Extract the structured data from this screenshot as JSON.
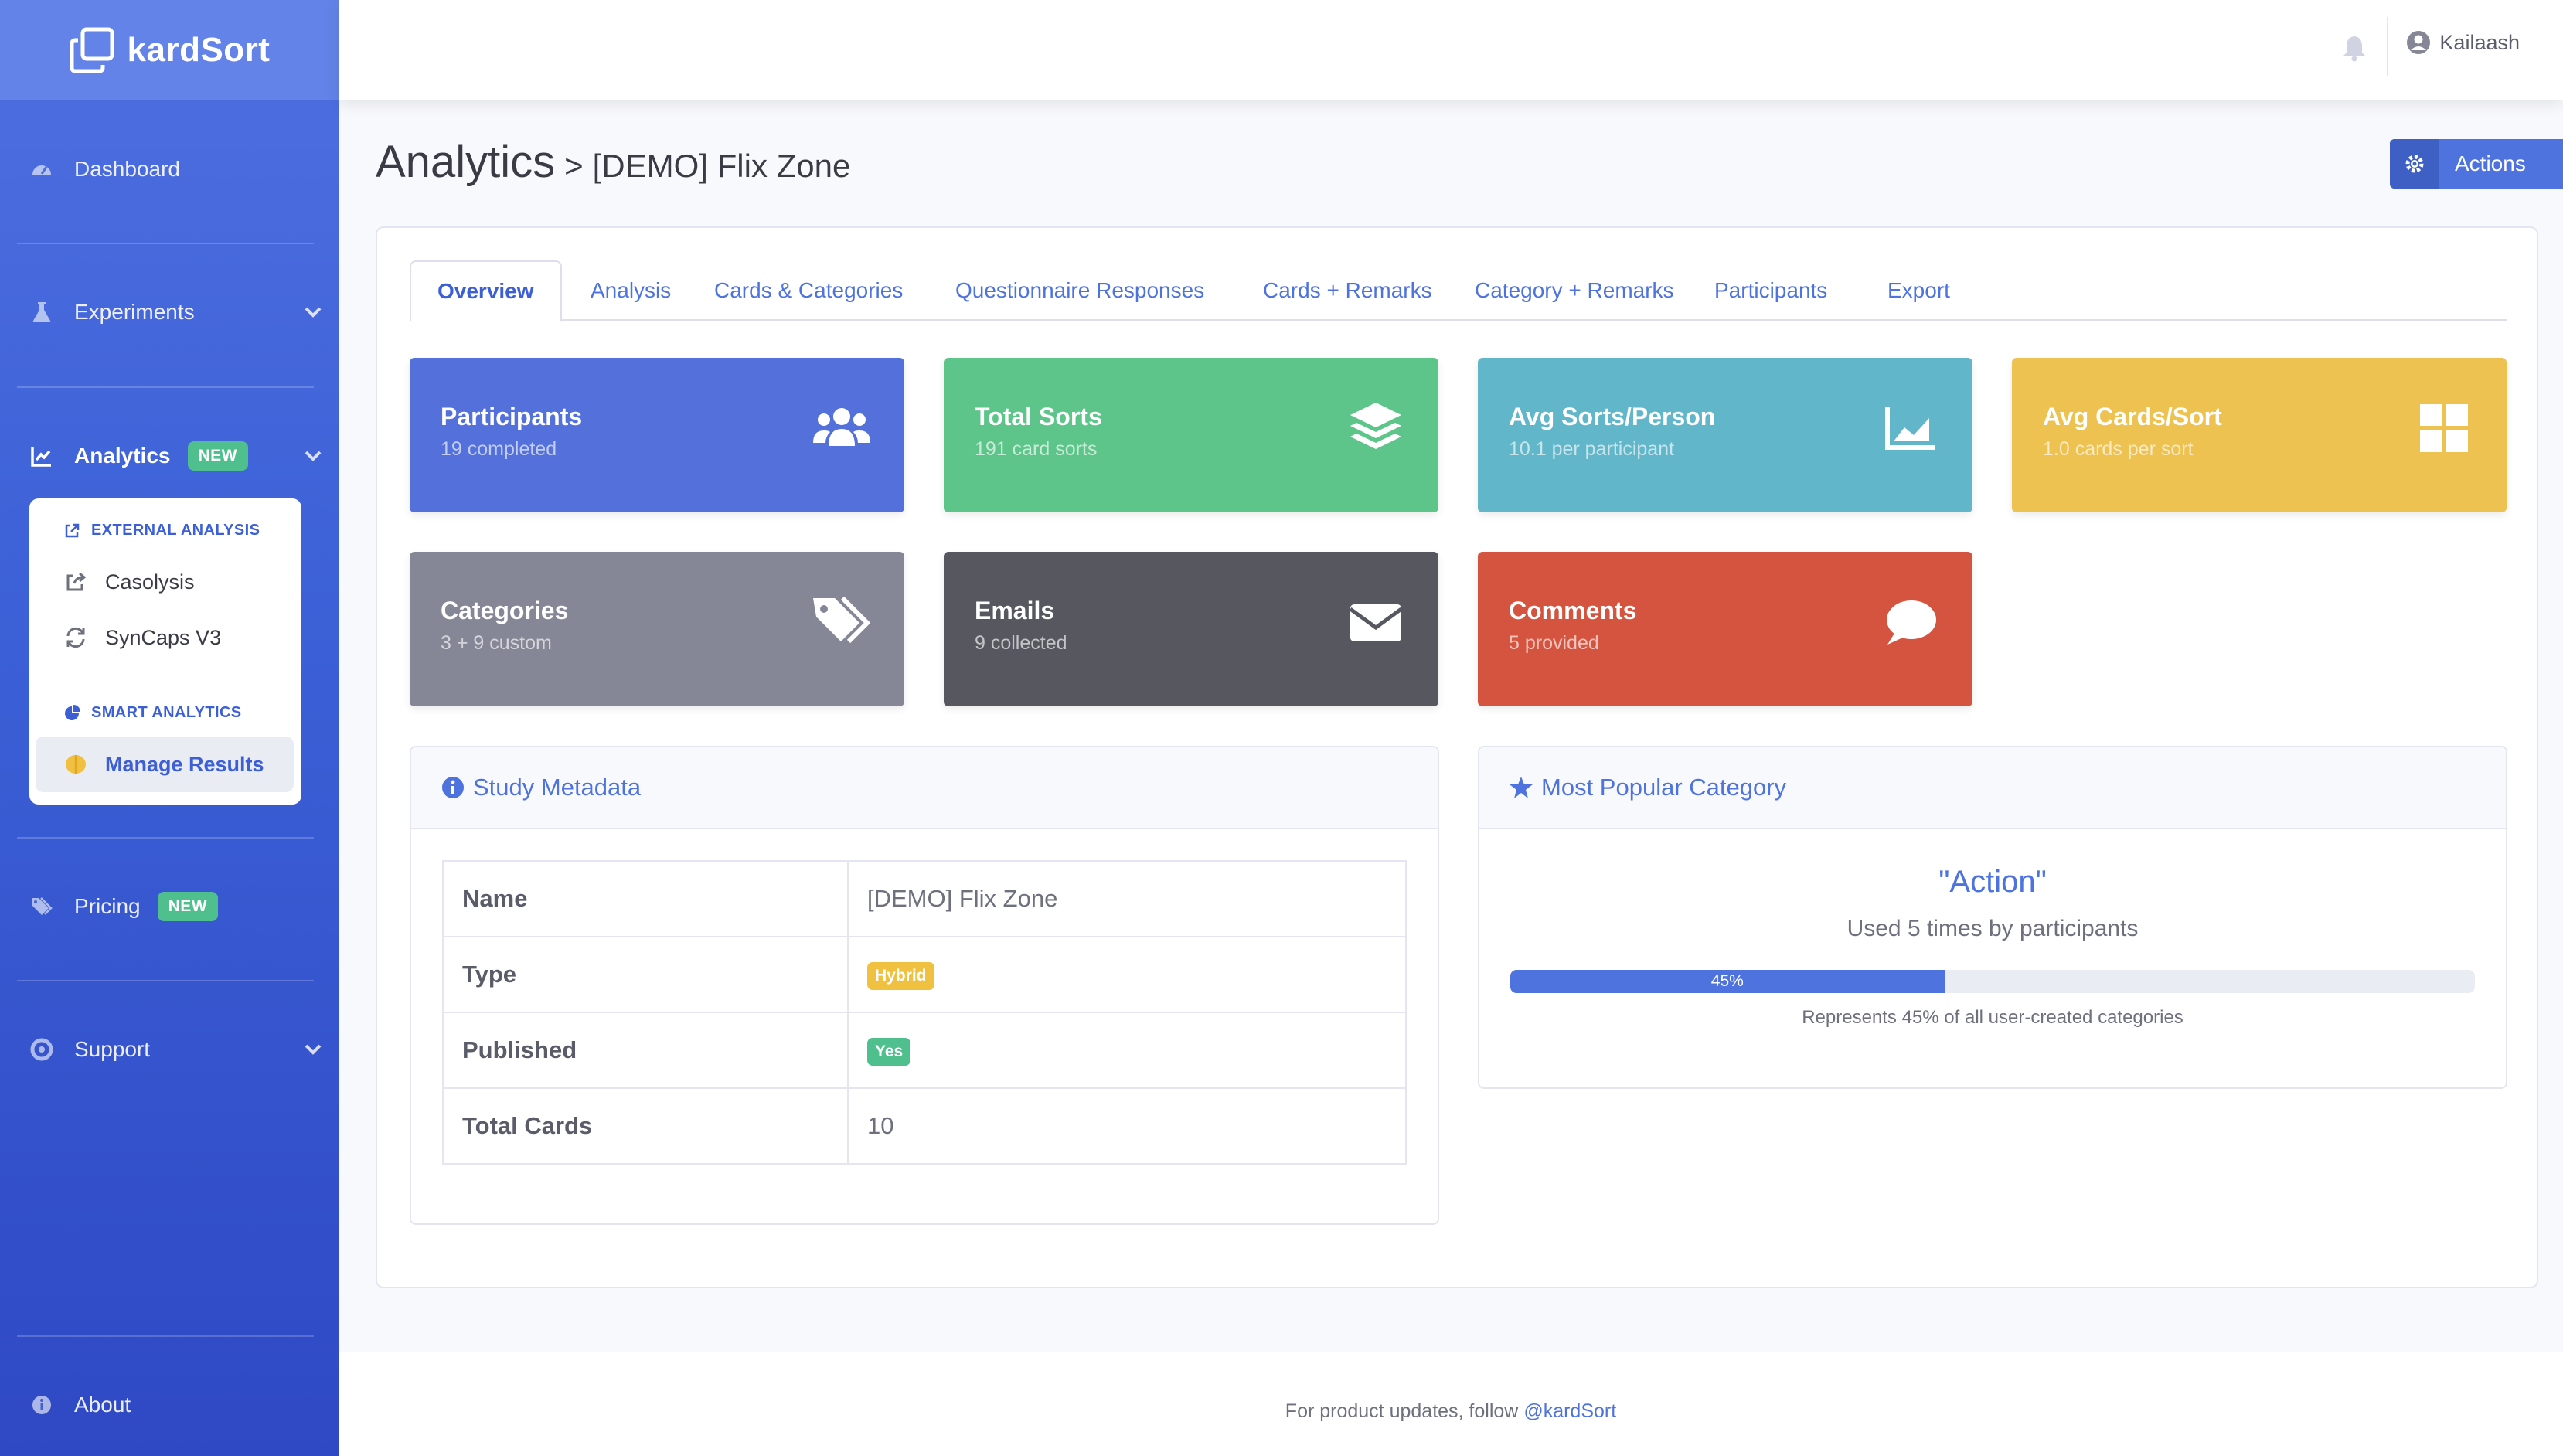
{
  "app": {
    "brand": "kardSort"
  },
  "sidebar": {
    "items": [
      {
        "label": "Dashboard",
        "icon": "gauge-icon"
      },
      {
        "label": "Experiments",
        "icon": "flask-icon"
      },
      {
        "label": "Analytics",
        "icon": "chart-line-icon",
        "badge": "NEW"
      },
      {
        "label": "Pricing",
        "icon": "tags-icon",
        "badge": "NEW"
      },
      {
        "label": "Support",
        "icon": "life-ring-icon"
      },
      {
        "label": "About",
        "icon": "info-circle-icon"
      }
    ],
    "submenu": {
      "external_header": "EXTERNAL ANALYSIS",
      "external_items": [
        {
          "label": "Casolysis",
          "icon": "share-square-icon"
        },
        {
          "label": "SynCaps V3",
          "icon": "sync-icon"
        }
      ],
      "smart_header": "SMART ANALYTICS",
      "smart_items": [
        {
          "label": "Manage Results",
          "icon": "brain-icon"
        }
      ]
    }
  },
  "topbar": {
    "user": "Kailaash"
  },
  "page": {
    "title": "Analytics",
    "separator": ">",
    "subtitle": "[DEMO] Flix Zone",
    "actions_label": "Actions"
  },
  "tabs": [
    "Overview",
    "Analysis",
    "Cards & Categories",
    "Questionnaire Responses",
    "Cards + Remarks",
    "Category + Remarks",
    "Participants",
    "Export"
  ],
  "stats": [
    {
      "title": "Participants",
      "sub": "19 completed",
      "color": "#5470db",
      "icon": "users-icon"
    },
    {
      "title": "Total Sorts",
      "sub": "191 card sorts",
      "color": "#5ec58a",
      "icon": "layer-group-icon"
    },
    {
      "title": "Avg Sorts/Person",
      "sub": "10.1 per participant",
      "color": "#62b6c9",
      "icon": "chart-area-icon"
    },
    {
      "title": "Avg Cards/Sort",
      "sub": "1.0 cards per sort",
      "color": "#edc251",
      "icon": "grid-icon"
    },
    {
      "title": "Categories",
      "sub": "3 + 9 custom",
      "color": "#858796",
      "icon": "tags-icon"
    },
    {
      "title": "Emails",
      "sub": "9 collected",
      "color": "#56575f",
      "icon": "envelope-icon"
    },
    {
      "title": "Comments",
      "sub": "5 provided",
      "color": "#d55440",
      "icon": "comment-icon"
    }
  ],
  "metadata": {
    "title": "Study Metadata",
    "rows": [
      {
        "key": "Name",
        "value": "[DEMO] Flix Zone"
      },
      {
        "key": "Type",
        "value": "Hybrid",
        "pill_color": "#f0c040"
      },
      {
        "key": "Published",
        "value": "Yes",
        "pill_color": "#4fc08d"
      },
      {
        "key": "Total Cards",
        "value": "10"
      }
    ]
  },
  "popular": {
    "title": "Most Popular Category",
    "name": "\"Action\"",
    "used": "Used 5 times by participants",
    "percent": 45,
    "percent_label": "45%",
    "note": "Represents 45% of all user-created categories"
  },
  "footer": {
    "text": "For product updates, follow",
    "link": "@kardSort"
  }
}
